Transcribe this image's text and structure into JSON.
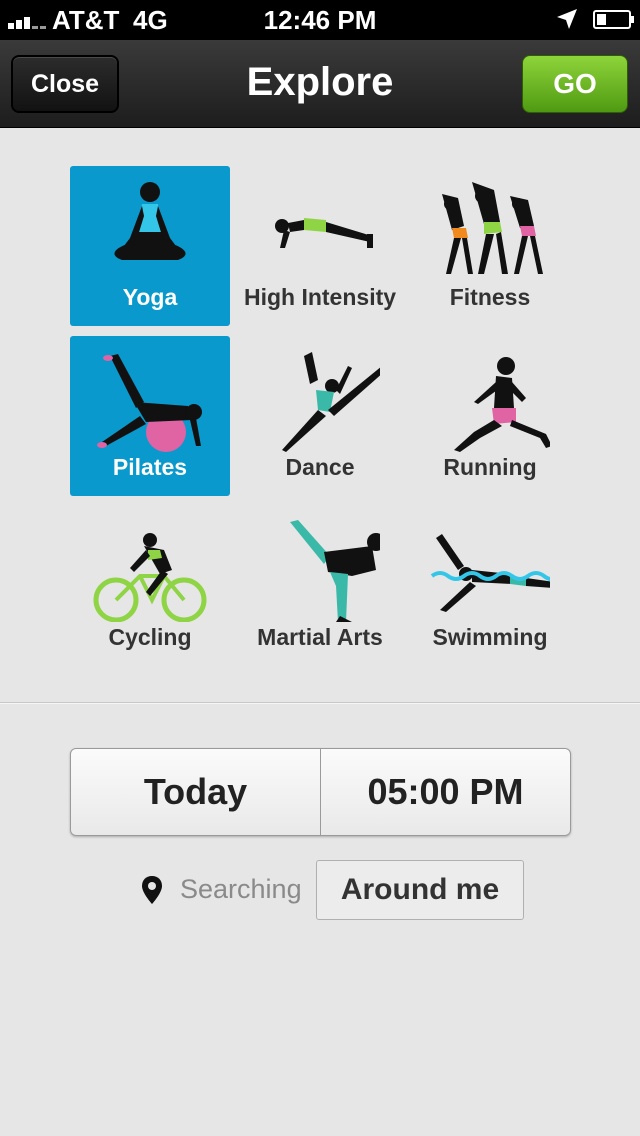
{
  "status_bar": {
    "carrier": "AT&T",
    "network": "4G",
    "time": "12:46 PM",
    "signal_bars_filled": 3,
    "signal_bars_total": 5,
    "battery_level": 0.3
  },
  "nav": {
    "title": "Explore",
    "close_label": "Close",
    "go_label": "GO"
  },
  "activities": [
    {
      "label": "Yoga",
      "selected": true
    },
    {
      "label": "High Intensity",
      "selected": false
    },
    {
      "label": "Fitness",
      "selected": false
    },
    {
      "label": "Pilates",
      "selected": true
    },
    {
      "label": "Dance",
      "selected": false
    },
    {
      "label": "Running",
      "selected": false
    },
    {
      "label": "Cycling",
      "selected": false
    },
    {
      "label": "Martial Arts",
      "selected": false
    },
    {
      "label": "Swimming",
      "selected": false
    }
  ],
  "schedule": {
    "day": "Today",
    "time": "05:00 PM"
  },
  "location": {
    "icon": "location-pin-icon",
    "searching_label": "Searching",
    "around_label": "Around me"
  },
  "colors": {
    "selected_tile": "#0a99cc",
    "go_button": "#6cbb22",
    "accent_cyan": "#34c6e8",
    "accent_green": "#8fd444",
    "accent_pink": "#e063a4",
    "accent_orange": "#f08a1e",
    "accent_teal": "#3ab9a8"
  }
}
